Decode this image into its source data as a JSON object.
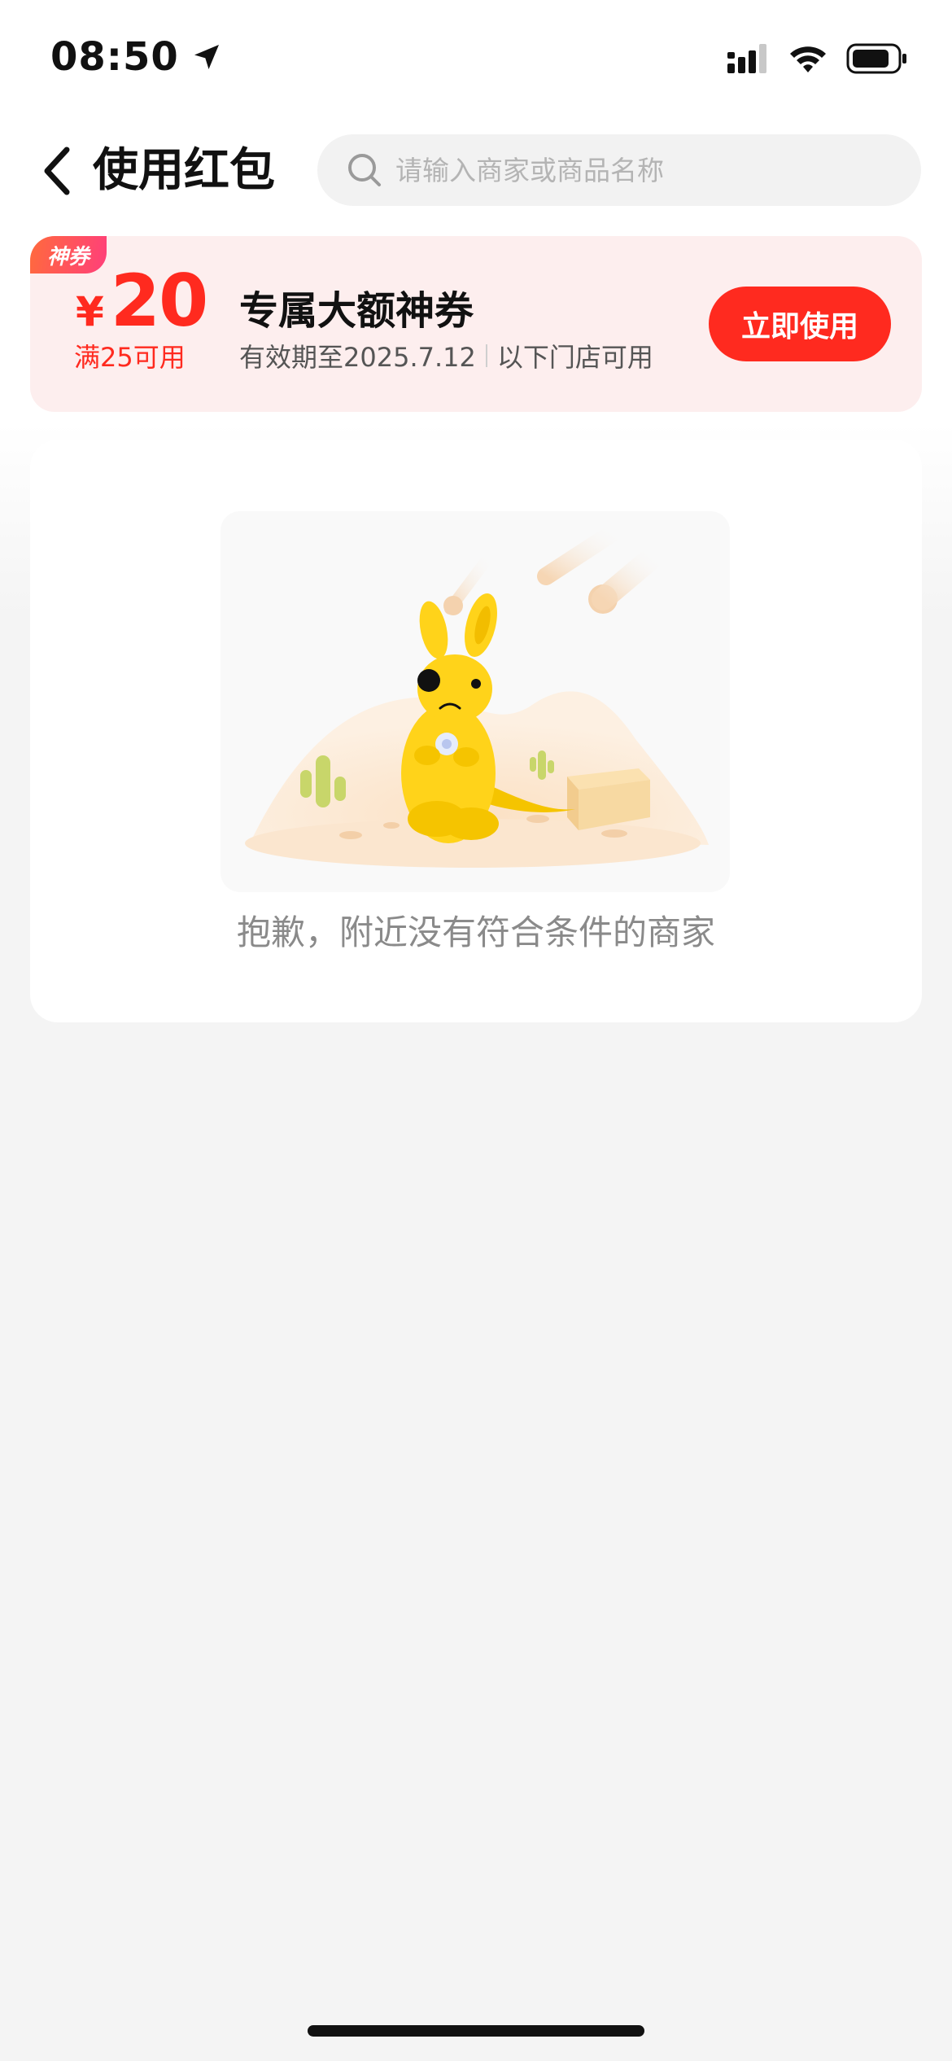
{
  "status_bar": {
    "time": "08:50",
    "icons": [
      "location-arrow-icon",
      "signal-icon",
      "wifi-icon",
      "battery-icon"
    ]
  },
  "header": {
    "title": "使用红包",
    "search_placeholder": "请输入商家或商品名称",
    "search_value": ""
  },
  "coupon": {
    "tag": "神券",
    "currency": "¥",
    "amount": "20",
    "threshold": "满25可用",
    "title": "专属大额神券",
    "validity": "有效期至2025.7.12",
    "scope": "以下门店可用",
    "button_label": "立即使用",
    "accent_color": "#ff2a1f",
    "background_color": "#fdeeee"
  },
  "empty_state": {
    "illustration": "sad-yellow-kangaroo-in-desert",
    "message": "抱歉，附近没有符合条件的商家"
  }
}
